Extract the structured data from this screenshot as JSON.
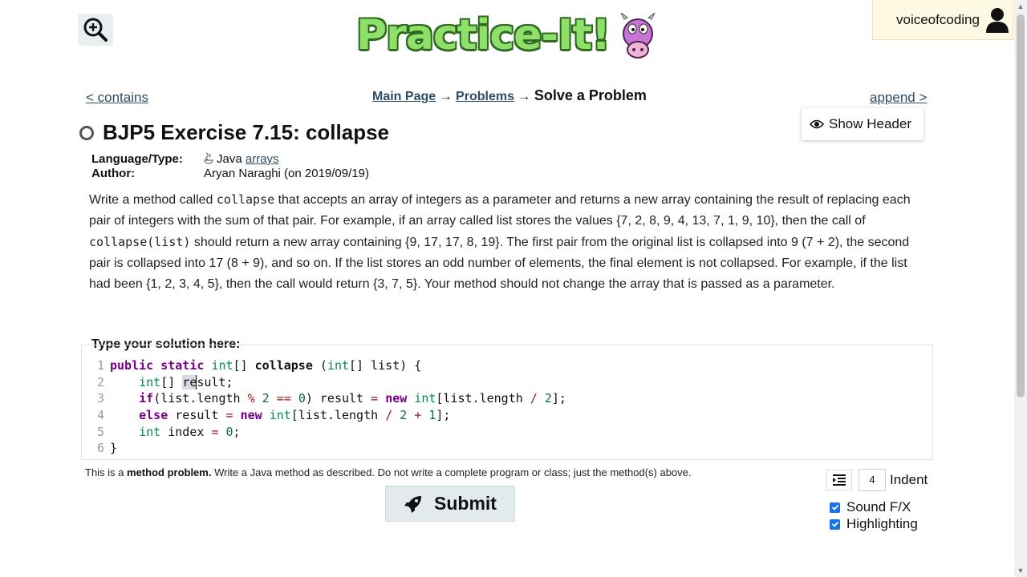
{
  "header": {
    "logo_text": "Practice-It!",
    "user": "voiceofcoding",
    "zoom_icon": "zoom-in-icon",
    "user_icon": "user-icon"
  },
  "nav": {
    "prev": "< contains",
    "next": "append >",
    "breadcrumb": {
      "main": "Main Page",
      "sep1": "→",
      "problems": "Problems",
      "sep2": "→",
      "current": "Solve a Problem"
    },
    "show_header": "Show Header"
  },
  "problem": {
    "title": "BJP5 Exercise 7.15: collapse",
    "lang_label": "Language/Type:",
    "lang": "Java",
    "lang_tag": "arrays",
    "author_label": "Author:",
    "author": "Aryan Naraghi (on 2019/09/19)",
    "desc": {
      "p1": "Write a method called ",
      "c1": "collapse",
      "p2": " that accepts an array of integers as a parameter and returns a new array containing the result of replacing each pair of integers with the sum of that pair. For example, if an array called list stores the values {7, 2, 8, 9, 4, 13, 7, 1, 9, 10}, then the call of ",
      "c2": "collapse(list)",
      "p3": " should return a new array containing {9, 17, 17, 8, 19}. The first pair from the original list is collapsed into 9 (7 + 2), the second pair is collapsed into 17 (8 + 9), and so on. If the list stores an odd number of elements, the final element is not collapsed. For example, if the list had been {1, 2, 3, 4, 5}, then the call would return {3, 7, 5}. Your method should not change the array that is passed as a parameter."
    }
  },
  "editor": {
    "label": "Type your solution here:",
    "line_numbers": [
      "1",
      "2",
      "3",
      "4",
      "5",
      "6"
    ]
  },
  "footer": {
    "note_prefix": "This is a ",
    "note_bold": "method problem.",
    "note_rest": " Write a Java method as described. Do not write a complete program or class; just the method(s) above.",
    "submit": "Submit",
    "indent_value": "4",
    "indent_label": "Indent",
    "sound": "Sound F/X",
    "sound_checked": true,
    "highlighting": "Highlighting",
    "highlighting_checked": true
  }
}
